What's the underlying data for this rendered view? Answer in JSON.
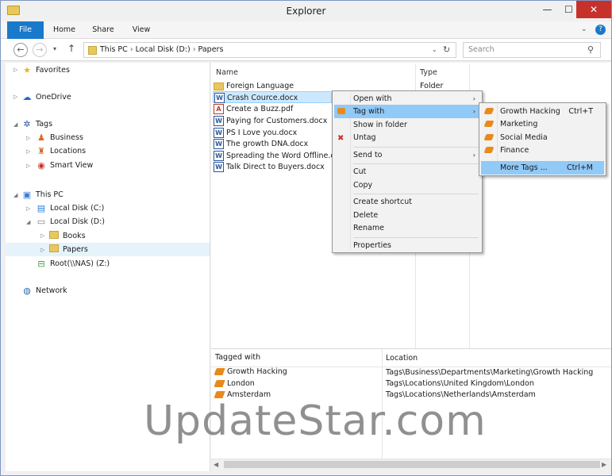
{
  "window": {
    "title": "Explorer",
    "minimize": "—",
    "maximize": "☐",
    "close": "✕"
  },
  "ribbon": {
    "tabs": [
      "File",
      "Home",
      "Share",
      "View"
    ]
  },
  "address": {
    "path": [
      "This PC",
      "Local Disk (D:)",
      "Papers"
    ],
    "separator": "›",
    "search_placeholder": "Search"
  },
  "nav": {
    "favorites": "Favorites",
    "onedrive": "OneDrive",
    "tags": "Tags",
    "tag_children": [
      "Business",
      "Locations",
      "Smart View"
    ],
    "this_pc": "This PC",
    "pc_children": [
      "Local Disk (C:)",
      "Local Disk (D:)"
    ],
    "d_children": [
      "Books",
      "Papers"
    ],
    "nas": "Root(\\\\NAS) (Z:)",
    "network": "Network"
  },
  "files": {
    "col_name": "Name",
    "col_type": "Type",
    "rows": [
      {
        "name": "Foreign Language",
        "type": "Folder"
      },
      {
        "name": "Crash Cource.docx",
        "type": ""
      },
      {
        "name": "Create a Buzz.pdf",
        "type": ""
      },
      {
        "name": "Paying for Customers.docx",
        "type": ""
      },
      {
        "name": "PS I Love you.docx",
        "type": ""
      },
      {
        "name": "The growth DNA.docx",
        "type": ""
      },
      {
        "name": "Spreading the Word Offline.docx",
        "type": ""
      },
      {
        "name": "Talk Direct to Buyers.docx",
        "type": ""
      }
    ]
  },
  "context_menu": {
    "open_with": "Open with",
    "tag_with": "Tag with",
    "show_in_folder": "Show in folder",
    "untag": "Untag",
    "send_to": "Send to",
    "cut": "Cut",
    "copy": "Copy",
    "create_shortcut": "Create shortcut",
    "delete": "Delete",
    "rename": "Rename",
    "properties": "Properties"
  },
  "submenu": {
    "items": [
      {
        "label": "Growth Hacking",
        "shortcut": "Ctrl+T"
      },
      {
        "label": "Marketing",
        "shortcut": ""
      },
      {
        "label": "Social Media",
        "shortcut": ""
      },
      {
        "label": "Finance",
        "shortcut": ""
      }
    ],
    "more": {
      "label": "More Tags ...",
      "shortcut": "Ctrl+M"
    }
  },
  "tagged": {
    "col_tagged": "Tagged with",
    "col_location": "Location",
    "rows": [
      {
        "tag": "Growth Hacking",
        "location": "Tags\\Business\\Departments\\Marketing\\Growth Hacking"
      },
      {
        "tag": "London",
        "location": "Tags\\Locations\\United Kingdom\\London"
      },
      {
        "tag": "Amsterdam",
        "location": "Tags\\Locations\\Netherlands\\Amsterdam"
      }
    ]
  },
  "watermark": "UpdateStar.com",
  "colors": {
    "accent": "#1979ca",
    "selection": "#cce8ff",
    "menu_highlight": "#91c9f7",
    "tag": "#e88a1a",
    "close": "#c7312b"
  }
}
